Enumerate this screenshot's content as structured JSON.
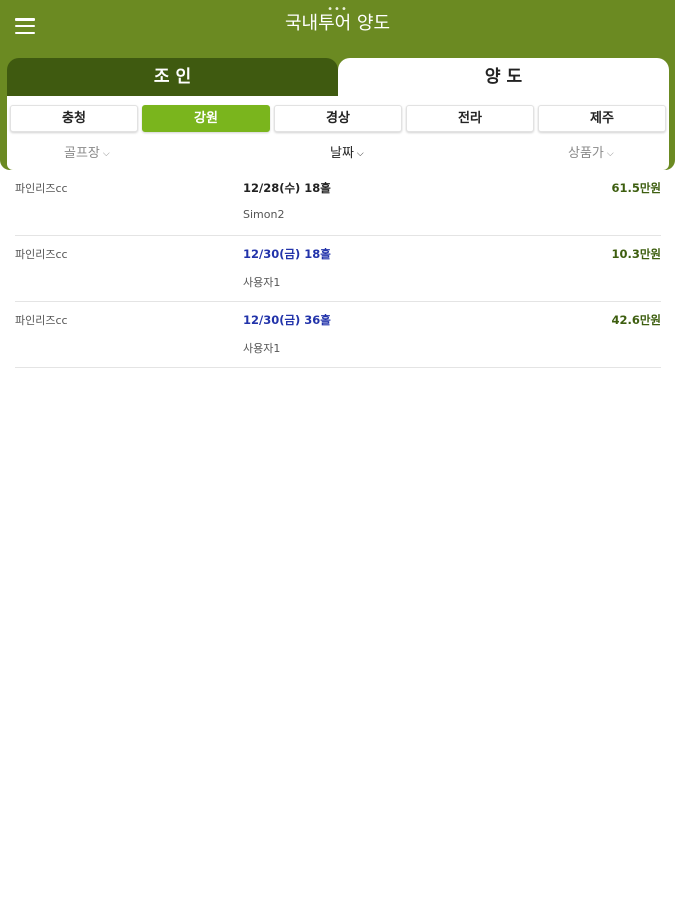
{
  "app": {
    "dots": "•••",
    "title": "국내투어 양도"
  },
  "seg_tabs": {
    "join": "조 인",
    "yangdo": "양 도",
    "selected": "yangdo"
  },
  "regions": {
    "items": [
      "충청",
      "강원",
      "경상",
      "전라",
      "제주"
    ],
    "active": "강원"
  },
  "sort": {
    "course_label": "골프장",
    "date_label": "날짜",
    "price_label": "상품가",
    "chevron": "⌵"
  },
  "listings": [
    {
      "course": "파인리즈cc",
      "date": "12/28(수) 18홀",
      "user": "Simon2",
      "price": "61.5만원"
    },
    {
      "course": "파인리즈cc",
      "date": "12/30(금) 18홀",
      "user": "사용자1",
      "price": "10.3만원"
    },
    {
      "course": "파인리즈cc",
      "date": "12/30(금) 36홀",
      "user": "사용자1",
      "price": "42.6만원"
    }
  ],
  "colors": {
    "header_bg": "#6b8a22",
    "join_tab_bg": "#3f5a10",
    "active_region_bg": "#7ab51d",
    "price_text": "#3d5e0f",
    "date_highlight": "#2233aa"
  }
}
